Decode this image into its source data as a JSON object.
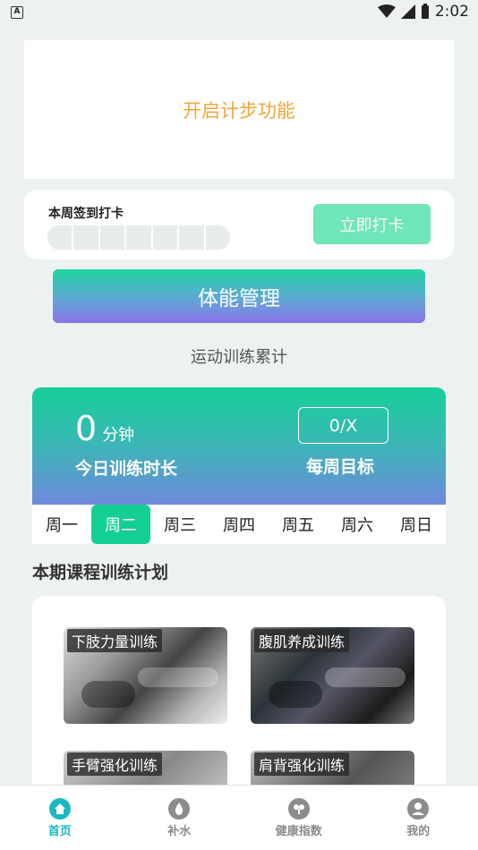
{
  "status_bar": {
    "notification": "A",
    "time": "2:02"
  },
  "step": {
    "enable_text": "开启计步功能"
  },
  "checkin": {
    "title": "本周签到打卡",
    "button": "立即打卡"
  },
  "fitness": {
    "button": "体能管理"
  },
  "training": {
    "section_title": "运动训练累计"
  },
  "stats": {
    "minutes": "0",
    "unit": "分钟",
    "today_label": "今日训练时长",
    "goal_value": "0/X",
    "goal_label": "每周目标"
  },
  "weekdays": [
    "周一",
    "周二",
    "周三",
    "周四",
    "周五",
    "周六",
    "周日"
  ],
  "selected_weekday": "周二",
  "plan": {
    "title": "本期课程训练计划",
    "courses": [
      "下肢力量训练",
      "腹肌养成训练",
      "手臂强化训练",
      "肩背强化训练"
    ]
  },
  "tabbar": [
    {
      "label": "首页",
      "icon": "home-icon",
      "active": true
    },
    {
      "label": "补水",
      "icon": "water-drop-icon",
      "active": false
    },
    {
      "label": "健康指数",
      "icon": "health-index-icon",
      "active": false
    },
    {
      "label": "我的",
      "icon": "user-icon",
      "active": false
    }
  ],
  "colors": {
    "accent": "#13cf93",
    "step_text": "#f3a53b",
    "tab_active": "#1cb7c4"
  }
}
